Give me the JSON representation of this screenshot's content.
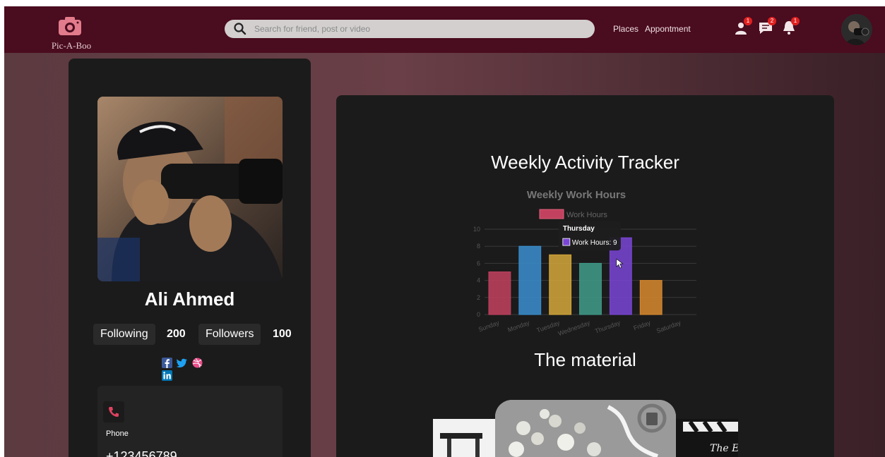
{
  "navbar": {
    "logo_text": "Pic-A-Boo",
    "search_placeholder": "Search for friend, post or video",
    "links": [
      "Places",
      "Appontment"
    ],
    "badges": {
      "friends": "1",
      "messages": "2",
      "notifications": "1"
    }
  },
  "profile": {
    "name": "Ali Ahmed",
    "following_label": "Following",
    "following_count": "200",
    "followers_label": "Followers",
    "followers_count": "100",
    "socials": [
      "facebook-icon",
      "twitter-icon",
      "dribbble-icon",
      "linkedin-icon"
    ],
    "phone_label": "Phone",
    "phone_number": "+123456789"
  },
  "main": {
    "title": "Weekly Activity Tracker",
    "material_title": "The material"
  },
  "chart_data": {
    "type": "bar",
    "title": "Weekly Work Hours",
    "legend": "Work Hours",
    "categories": [
      "Sunday",
      "Monday",
      "Tuesday",
      "Wednesday",
      "Thursday",
      "Friday",
      "Saturday"
    ],
    "values": [
      5,
      8,
      7,
      6,
      9,
      4,
      null
    ],
    "colors": [
      "#c2415f",
      "#3a8ecf",
      "#d4a73a",
      "#3f9c8a",
      "#7a45d6",
      "#d8892f"
    ],
    "ylim": [
      0,
      10
    ],
    "yticks": [
      0,
      2,
      4,
      6,
      8,
      10
    ],
    "tooltip": {
      "title": "Thursday",
      "label": "Work Hours: 9"
    }
  },
  "colors": {
    "navbar": "#4a0c1f",
    "card": "#1b1b1b",
    "accent": "#e0425f"
  }
}
